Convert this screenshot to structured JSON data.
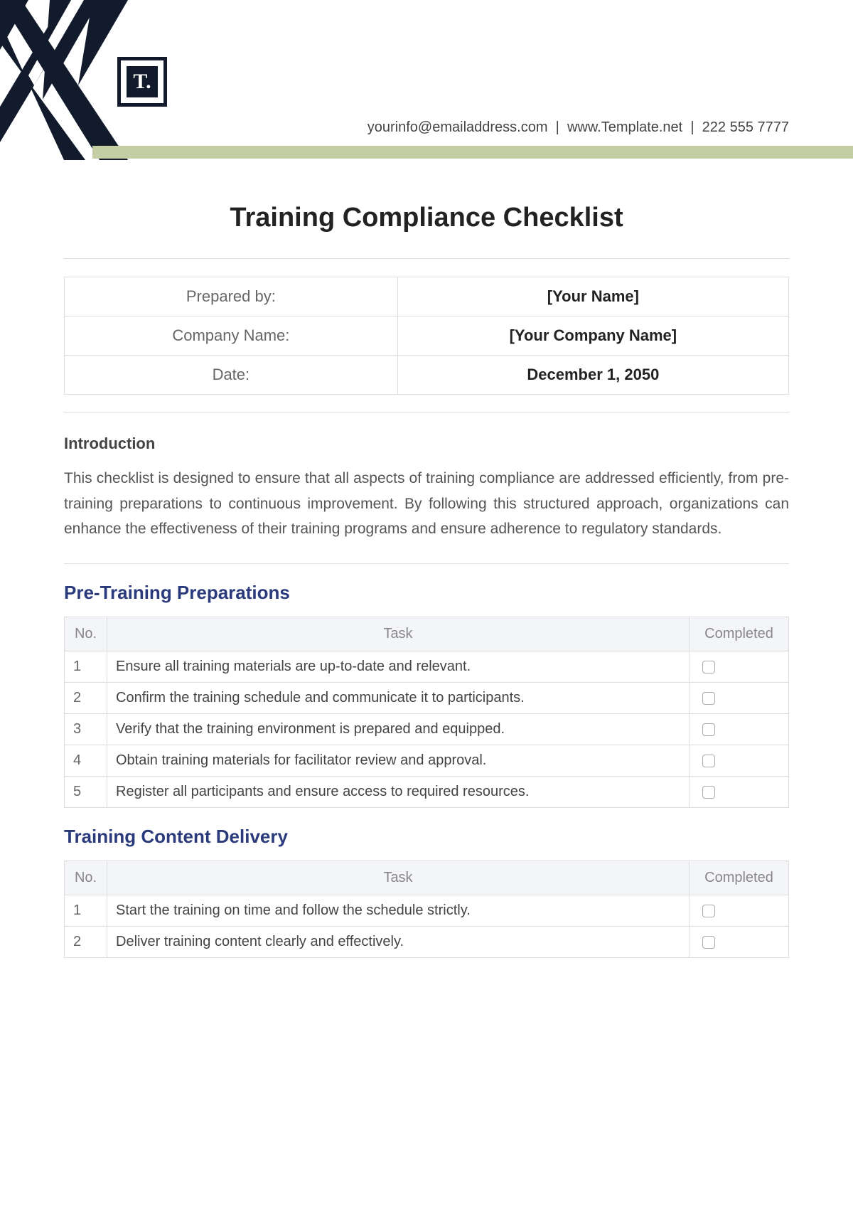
{
  "header": {
    "logo_text": "T.",
    "contact_email": "yourinfo@emailaddress.com",
    "contact_website": "www.Template.net",
    "contact_phone": "222 555 7777"
  },
  "title": "Training Compliance Checklist",
  "meta": {
    "rows": [
      {
        "label": "Prepared by:",
        "value": "[Your Name]"
      },
      {
        "label": "Company Name:",
        "value": "[Your Company Name]"
      },
      {
        "label": "Date:",
        "value": "December 1, 2050"
      }
    ]
  },
  "introduction": {
    "heading": "Introduction",
    "text": "This checklist is designed to ensure that all aspects of training compliance are addressed efficiently, from pre-training preparations to continuous improvement. By following this structured approach, organizations can enhance the effectiveness of their training programs and ensure adherence to regulatory standards."
  },
  "table_headers": {
    "no": "No.",
    "task": "Task",
    "completed": "Completed"
  },
  "sections": [
    {
      "heading": "Pre-Training Preparations",
      "tasks": [
        {
          "no": "1",
          "task": "Ensure all training materials are up-to-date and relevant.",
          "completed": false
        },
        {
          "no": "2",
          "task": "Confirm the training schedule and communicate it to participants.",
          "completed": false
        },
        {
          "no": "3",
          "task": "Verify that the training environment is prepared and equipped.",
          "completed": false
        },
        {
          "no": "4",
          "task": "Obtain training materials for facilitator review and approval.",
          "completed": false
        },
        {
          "no": "5",
          "task": "Register all participants and ensure access to required resources.",
          "completed": false
        }
      ]
    },
    {
      "heading": "Training Content Delivery",
      "tasks": [
        {
          "no": "1",
          "task": "Start the training on time and follow the schedule strictly.",
          "completed": false
        },
        {
          "no": "2",
          "task": "Deliver training content clearly and effectively.",
          "completed": false
        }
      ]
    }
  ]
}
